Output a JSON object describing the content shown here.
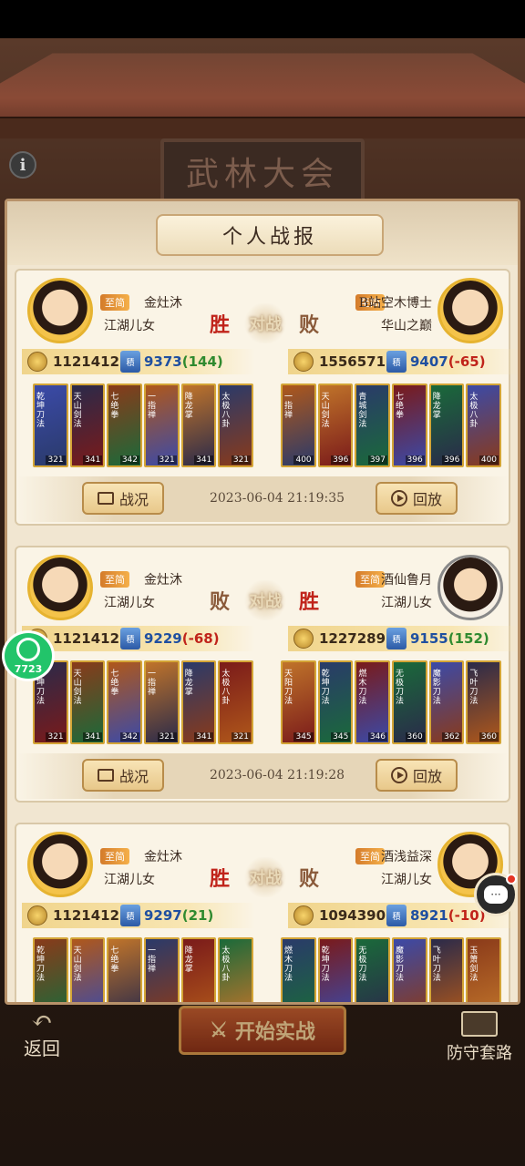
{
  "header": {
    "hall_sign": "武林大会",
    "panel_title": "个人战报"
  },
  "vs_label": "对战",
  "battles": [
    {
      "left": {
        "badge": "至简",
        "name": "金灶沐",
        "guild": "江湖儿女",
        "result": "胜",
        "power": "1121412",
        "score": "9373",
        "delta": "(144)",
        "delta_sign": "pos",
        "heroes": [
          {
            "name": "乾坤刀法",
            "lvl": "321"
          },
          {
            "name": "天山剑法",
            "lvl": "341"
          },
          {
            "name": "七绝拳",
            "lvl": "342"
          },
          {
            "name": "一指禅",
            "lvl": "321"
          },
          {
            "name": "降龙掌",
            "lvl": "341"
          },
          {
            "name": "太极八卦",
            "lvl": "321"
          }
        ]
      },
      "right": {
        "badge": "至简",
        "name": "B站空木博士",
        "guild": "华山之巅",
        "result": "败",
        "power": "1556571",
        "score": "9407",
        "delta": "(-65)",
        "delta_sign": "neg",
        "heroes": [
          {
            "name": "一指禅",
            "lvl": "400"
          },
          {
            "name": "天山剑法",
            "lvl": "396"
          },
          {
            "name": "青城剑法",
            "lvl": "397"
          },
          {
            "name": "七绝拳",
            "lvl": "396"
          },
          {
            "name": "降龙掌",
            "lvl": "396"
          },
          {
            "name": "太极八卦",
            "lvl": "400"
          }
        ]
      },
      "time": "2023-06-04 21:19:35"
    },
    {
      "left": {
        "badge": "至简",
        "name": "金灶沐",
        "guild": "江湖儿女",
        "result": "败",
        "power": "1121412",
        "score": "9229",
        "delta": "(-68)",
        "delta_sign": "neg",
        "heroes": [
          {
            "name": "乾坤刀法",
            "lvl": "321"
          },
          {
            "name": "天山剑法",
            "lvl": "341"
          },
          {
            "name": "七绝拳",
            "lvl": "342"
          },
          {
            "name": "一指禅",
            "lvl": "321"
          },
          {
            "name": "降龙掌",
            "lvl": "341"
          },
          {
            "name": "太极八卦",
            "lvl": "321"
          }
        ]
      },
      "right": {
        "badge": "至简",
        "name": "酒仙鲁月",
        "guild": "江湖儿女",
        "result": "胜",
        "power": "1227289",
        "score": "9155",
        "delta": "(152)",
        "delta_sign": "pos",
        "heroes": [
          {
            "name": "天阳刀法",
            "lvl": "345"
          },
          {
            "name": "乾坤刀法",
            "lvl": "345"
          },
          {
            "name": "燃木刀法",
            "lvl": "346"
          },
          {
            "name": "无极刀法",
            "lvl": "360"
          },
          {
            "name": "魔影刀法",
            "lvl": "362"
          },
          {
            "name": "飞叶刀法",
            "lvl": "360"
          }
        ]
      },
      "time": "2023-06-04 21:19:28"
    },
    {
      "left": {
        "badge": "至简",
        "name": "金灶沐",
        "guild": "江湖儿女",
        "result": "胜",
        "power": "1121412",
        "score": "9297",
        "delta": "(21)",
        "delta_sign": "pos",
        "heroes": [
          {
            "name": "乾坤刀法",
            "lvl": ""
          },
          {
            "name": "天山剑法",
            "lvl": ""
          },
          {
            "name": "七绝拳",
            "lvl": ""
          },
          {
            "name": "一指禅",
            "lvl": ""
          },
          {
            "name": "降龙掌",
            "lvl": ""
          },
          {
            "name": "太极八卦",
            "lvl": ""
          }
        ]
      },
      "right": {
        "badge": "至简",
        "name": "酒浅益深",
        "guild": "江湖儿女",
        "result": "败",
        "power": "1094390",
        "score": "8921",
        "delta": "(-10)",
        "delta_sign": "neg",
        "heroes": [
          {
            "name": "燃木刀法",
            "lvl": ""
          },
          {
            "name": "乾坤刀法",
            "lvl": ""
          },
          {
            "name": "无极刀法",
            "lvl": ""
          },
          {
            "name": "魔影刀法",
            "lvl": ""
          },
          {
            "name": "飞叶刀法",
            "lvl": ""
          },
          {
            "name": "玉箫剑法",
            "lvl": ""
          }
        ]
      },
      "time": ""
    }
  ],
  "buttons": {
    "report": "战况",
    "replay": "回放"
  },
  "bottom": {
    "back": "返回",
    "start": "开始实战",
    "defend": "防守套路"
  },
  "floating": {
    "app_label": "7723"
  },
  "colors": {
    "win": "#c0231a",
    "lose": "#8a5a3a",
    "score": "#1f4fa0",
    "delta_pos": "#2f8a2f",
    "delta_neg": "#c0231a",
    "gold_frame": "#d4a536"
  }
}
